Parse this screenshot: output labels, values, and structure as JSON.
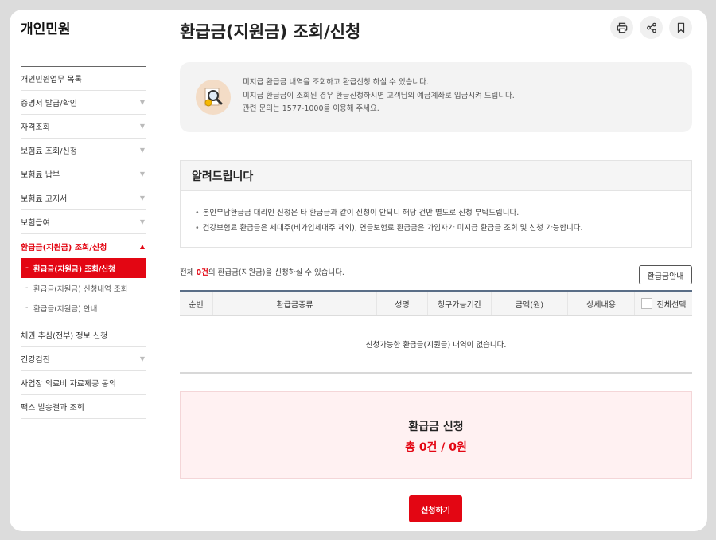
{
  "sidebar": {
    "title": "개인민원",
    "items": [
      {
        "label": "개인민원업무 목록",
        "arrow": ""
      },
      {
        "label": "증명서 발급/확인",
        "arrow": "▼"
      },
      {
        "label": "자격조회",
        "arrow": "▼"
      },
      {
        "label": "보험료 조회/신청",
        "arrow": "▼"
      },
      {
        "label": "보험료 납부",
        "arrow": "▼"
      },
      {
        "label": "보험료 고지서",
        "arrow": "▼"
      },
      {
        "label": "보험급여",
        "arrow": "▼"
      },
      {
        "label": "환급금(지원금) 조회/신청",
        "arrow": "▲"
      },
      {
        "label": "채권 추심(전부) 정보 신청",
        "arrow": ""
      },
      {
        "label": "건강검진",
        "arrow": "▼"
      },
      {
        "label": "사업장 의료비 자료제공 동의",
        "arrow": ""
      },
      {
        "label": "팩스 발송결과 조회",
        "arrow": ""
      }
    ],
    "sub_items": [
      {
        "label": "환급금(지원금) 조회/신청"
      },
      {
        "label": "환급금(지원금) 신청내역 조회"
      },
      {
        "label": "환급금(지원금) 안내"
      }
    ]
  },
  "page": {
    "title": "환급금(지원금) 조회/신청"
  },
  "tools": {
    "print_icon": "printer-icon",
    "share_icon": "share-icon",
    "bookmark_icon": "bookmark-icon"
  },
  "info": {
    "icon": "magnifier-coin-icon",
    "lines": [
      "미지급 환급금 내역을 조회하고 환급신청 하실 수 있습니다.",
      "미지급 환급금이 조회된 경우 환급신청하시면 고객님의 예금계좌로 입금시켜 드립니다.",
      "관련 문의는 1577-1000을 이용해 주세요."
    ]
  },
  "notice": {
    "title": "알려드립니다",
    "bullet": "•",
    "items": [
      "본인부담환급금 대리인 신청은 타 환급금과 같이 신청이 안되니 해당 건만 별도로 신청 부탁드립니다.",
      "건강보험료 환급금은 세대주(비가입세대주 제외), 연금보험료 환급금은 가입자가 미지급 환급금 조회 및 신청 가능합니다."
    ]
  },
  "count": {
    "prefix": "전체 ",
    "number": "0건",
    "suffix": "의 환급금(지원금)을 신청하실 수 있습니다."
  },
  "guide_button": "환급금안내",
  "table": {
    "headers": [
      "순번",
      "환급금종류",
      "성명",
      "청구가능기간",
      "금액(원)",
      "상세내용",
      "전체선택"
    ],
    "empty_message": "신청가능한 환급금(지원금) 내역이 없습니다."
  },
  "summary": {
    "title": "환급금 신청",
    "total": "총 0건 / 0원"
  },
  "apply_button": "신청하기",
  "colors": {
    "accent": "#e30613",
    "table_border": "#5a6e87",
    "summary_bg": "#fff1f2"
  }
}
